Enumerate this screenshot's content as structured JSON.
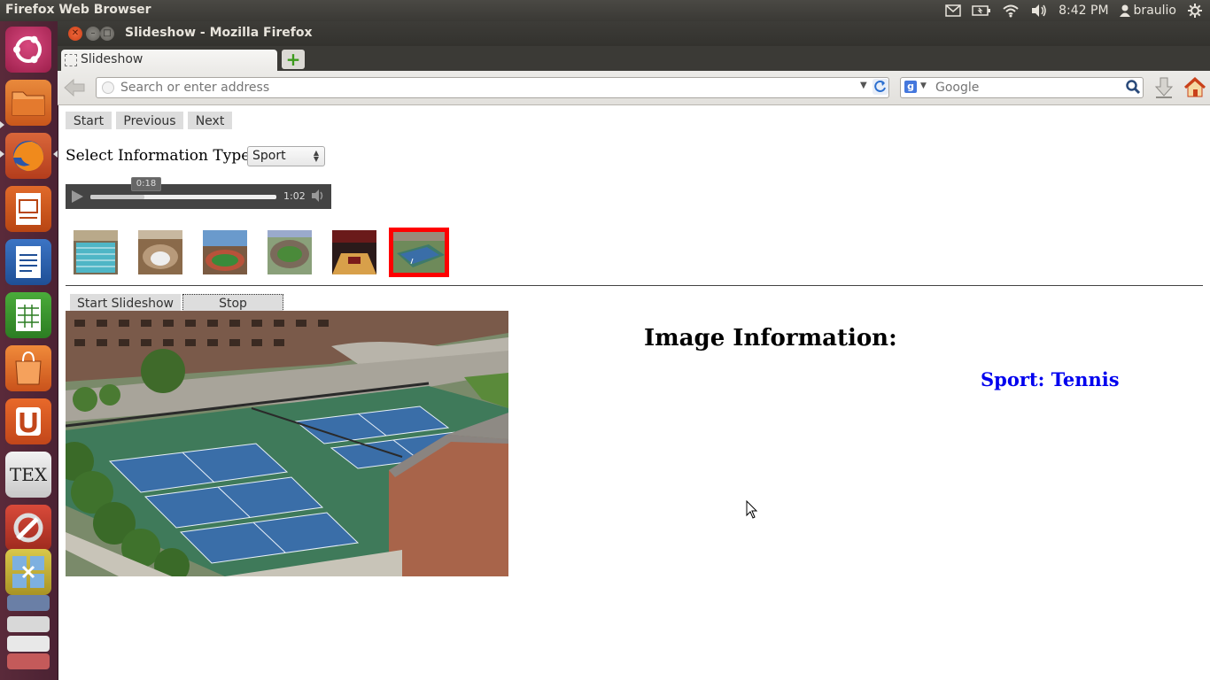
{
  "top_panel": {
    "app_name": "Firefox Web Browser",
    "clock": "8:42 PM",
    "user": "braulio",
    "icons": [
      "mail-icon",
      "battery-icon",
      "wifi-icon",
      "volume-icon",
      "user-icon",
      "gear-icon"
    ]
  },
  "launcher": {
    "items": [
      "dash-home",
      "files",
      "firefox",
      "libreoffice-impress",
      "libreoffice-writer",
      "libreoffice-calc",
      "ubuntu-software-center",
      "ubuntu-one",
      "texmaker",
      "system-settings",
      "workspace-switcher",
      "stacked-apps"
    ]
  },
  "window": {
    "title": "Slideshow - Mozilla Firefox",
    "tab_label": "Slideshow",
    "url_placeholder": "Search or enter address",
    "search_placeholder": "Google"
  },
  "page": {
    "nav_buttons": {
      "start": "Start",
      "previous": "Previous",
      "next": "Next"
    },
    "info_type_label": "Select Information Type:",
    "info_type_selected": "Sport",
    "audio": {
      "current_time": "0:18",
      "duration": "1:02",
      "progress_fraction": 0.29
    },
    "thumbnails": [
      "pool",
      "arena",
      "stadium-track",
      "stadium-aerial",
      "basketball-court",
      "tennis-courts"
    ],
    "selected_thumbnail_index": 5,
    "slideshow_buttons": {
      "start": "Start Slideshow",
      "stop": "Stop Slideshow"
    },
    "info_heading": "Image Information:",
    "info_value": "Sport: Tennis"
  },
  "colors": {
    "launcher_bg": "#4b2233",
    "panel_bg": "#3c3b37",
    "link_blue": "#0000ee",
    "selected_border": "#ff0000"
  }
}
